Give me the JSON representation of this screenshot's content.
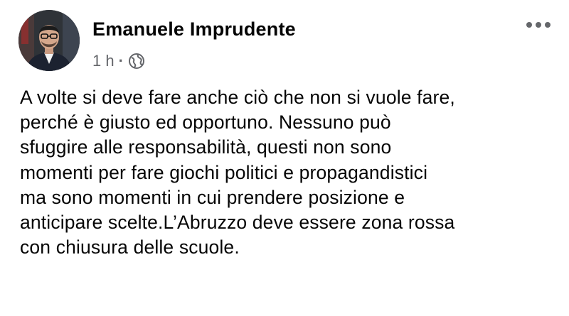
{
  "post": {
    "author": "Emanuele Imprudente",
    "time": "1 h",
    "separator": "·",
    "privacy_icon": "globe-icon",
    "more_icon": "ellipsis-icon",
    "avatar_icon": "profile-avatar",
    "body_lines": [
      "A volte si deve fare anche ciò che non si vuole fare,",
      "perché è giusto ed opportuno. Nessuno può",
      "sfuggire alle responsabilità, questi non sono",
      "momenti per fare giochi politici e propagandistici",
      "ma sono momenti in cui prendere posizione e",
      "anticipare scelte.L’Abruzzo deve essere zona rossa",
      "con chiusura delle scuole."
    ]
  },
  "colors": {
    "text": "#050505",
    "secondary": "#65676b",
    "background": "#ffffff"
  }
}
